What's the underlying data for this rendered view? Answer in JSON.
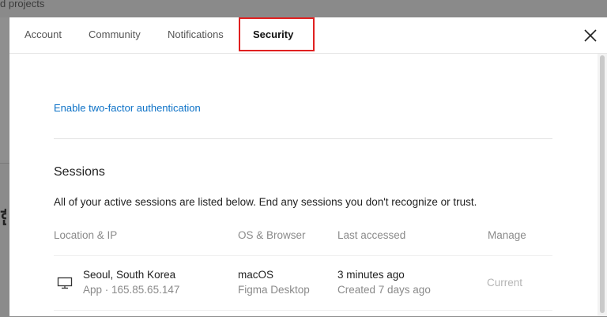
{
  "background": {
    "partial_text": "d projects"
  },
  "tabs": [
    {
      "label": "Account"
    },
    {
      "label": "Community"
    },
    {
      "label": "Notifications"
    },
    {
      "label": "Security",
      "active": true
    }
  ],
  "security": {
    "two_factor_link": "Enable two-factor authentication",
    "sessions": {
      "title": "Sessions",
      "description": "All of your active sessions are listed below. End any sessions you don't recognize or trust.",
      "columns": [
        "Location & IP",
        "OS & Browser",
        "Last accessed",
        "Manage"
      ],
      "rows": [
        {
          "device_icon": "monitor-icon",
          "location": "Seoul, South Korea",
          "ip": "App · 165.85.65.147",
          "os": "macOS",
          "browser": "Figma Desktop",
          "last_accessed": "3 minutes ago",
          "created": "Created 7 days ago",
          "manage": "Current"
        }
      ]
    }
  },
  "colors": {
    "link": "#0d72c7",
    "highlight_box": "#e02020",
    "overlay": "#8c8c8c"
  }
}
